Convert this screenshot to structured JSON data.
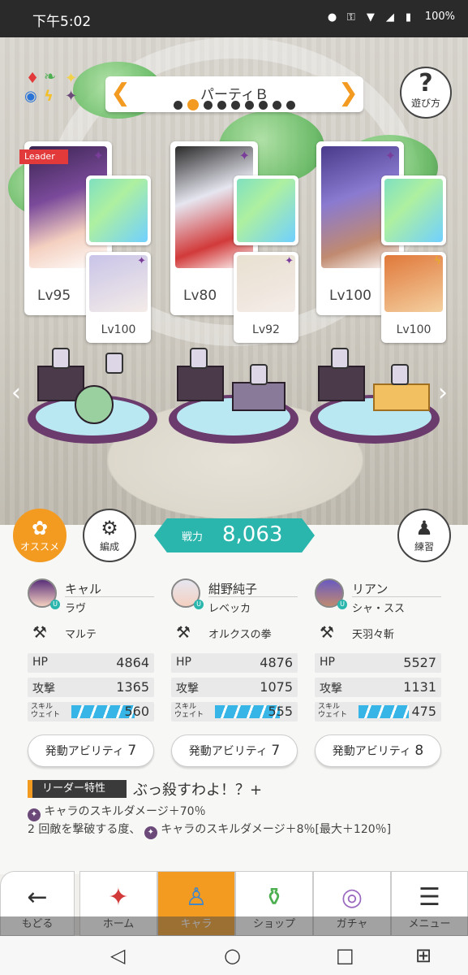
{
  "status": {
    "time": "下午5:02",
    "battery": "100%"
  },
  "party": {
    "name": "パーティＢ",
    "prev_icon": "chevron-left-icon",
    "next_icon": "chevron-right-icon",
    "pages": 9,
    "active_page": 2
  },
  "help": {
    "label": "遊び方"
  },
  "cards": [
    {
      "level": "Lv95",
      "leader_tag": "Leader",
      "sub_level": "Lv100"
    },
    {
      "level": "Lv80",
      "sub_level": "Lv92"
    },
    {
      "level": "Lv100",
      "sub_level": "Lv100"
    }
  ],
  "buttons": {
    "osusume": "オススメ",
    "hensei": "編成",
    "renshu": "練習"
  },
  "power": {
    "label": "戦力",
    "value": "8,063"
  },
  "characters": [
    {
      "name": "キャル",
      "support": "ラヴ",
      "weapon": "マルテ",
      "hp": "4864",
      "atk": "1365",
      "skill_wait": "560",
      "skill_fill": 0.78,
      "ability_label": "発動アビリティ",
      "ability_count": "7"
    },
    {
      "name": "紺野純子",
      "support": "レベッカ",
      "weapon": "オルクスの拳",
      "hp": "4876",
      "atk": "1075",
      "skill_wait": "555",
      "skill_fill": 0.8,
      "ability_label": "発動アビリティ",
      "ability_count": "7"
    },
    {
      "name": "リアン",
      "support": "シャ・スス",
      "weapon": "天羽々斬",
      "hp": "5527",
      "atk": "1131",
      "skill_wait": "475",
      "skill_fill": 0.62,
      "ability_label": "発動アビリティ",
      "ability_count": "8"
    }
  ],
  "stat_labels": {
    "hp": "HP",
    "atk": "攻撃",
    "skill_line1": "スキル",
    "skill_line2": "ウェイト"
  },
  "leader": {
    "label": "リーダー特性",
    "skill_name": "ぶっ殺すわよ！？+",
    "desc1": "キャラのスキルダメージ＋70％",
    "desc2a": "2 回敵を撃破する度、",
    "desc2b": "キャラのスキルダメージ＋8％[最大＋120％]"
  },
  "nav": [
    {
      "label": "もどる",
      "icon": "back-arrow-icon"
    },
    {
      "label": "ホーム",
      "icon": "home-icon"
    },
    {
      "label": "キャラ",
      "icon": "character-icon"
    },
    {
      "label": "ショップ",
      "icon": "shop-icon"
    },
    {
      "label": "ガチャ",
      "icon": "gacha-icon"
    },
    {
      "label": "メニュー",
      "icon": "menu-icon"
    }
  ],
  "colors": {
    "accent": "#f39a21",
    "teal": "#2bb6ad",
    "skill_bar": "#36b5e6",
    "leader_red": "#e23a3a"
  }
}
